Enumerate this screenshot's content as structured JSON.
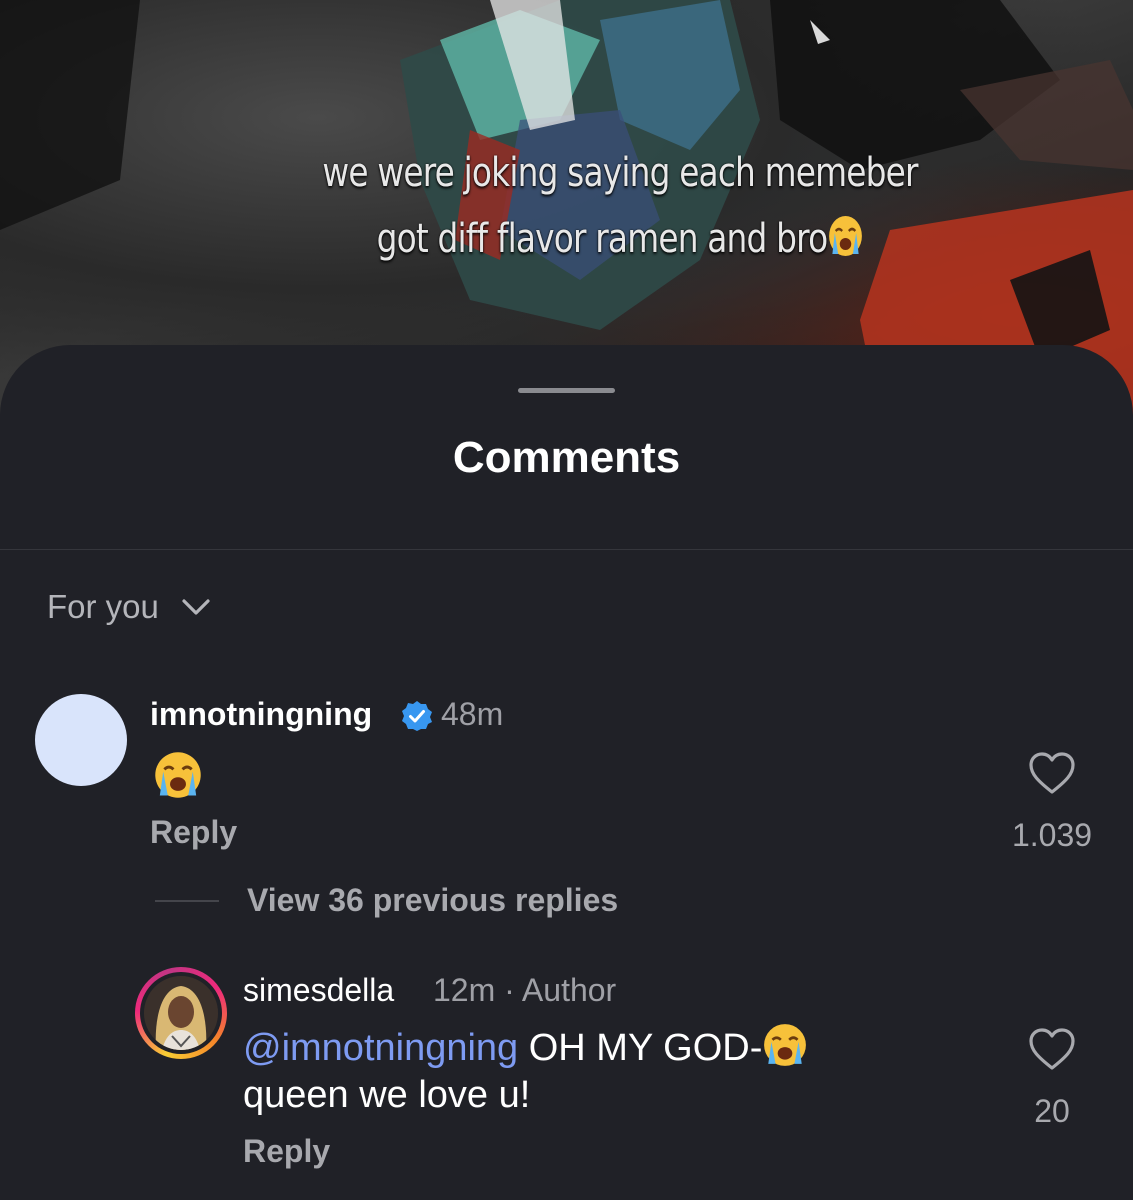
{
  "video": {
    "caption_line1": "we were joking saying each memeber",
    "caption_line2": "got diff flavor ramen and bro",
    "caption_emoji": "loudly-crying-face"
  },
  "sheet": {
    "title": "Comments",
    "filter_label": "For you",
    "filter_icon": "chevron-down-icon"
  },
  "comment": {
    "username": "imnotningning",
    "verified": true,
    "time": "48m",
    "body_emoji": "loudly-crying-face",
    "reply_label": "Reply",
    "like_count": "1.039",
    "view_replies": "View 36 previous replies"
  },
  "reply": {
    "username": "simesdella",
    "time": "12m",
    "separator": "·",
    "role": "Author",
    "mention": "@imnotningning",
    "text_part1": "OH MY GOD-",
    "text_part2": "queen we love u!",
    "reply_label": "Reply",
    "like_count": "20"
  },
  "colors": {
    "sheet_bg": "#202127",
    "mention": "#7e9bf2",
    "verified_badge": "#3897f0",
    "avatar_placeholder": "#d9e4fb"
  }
}
